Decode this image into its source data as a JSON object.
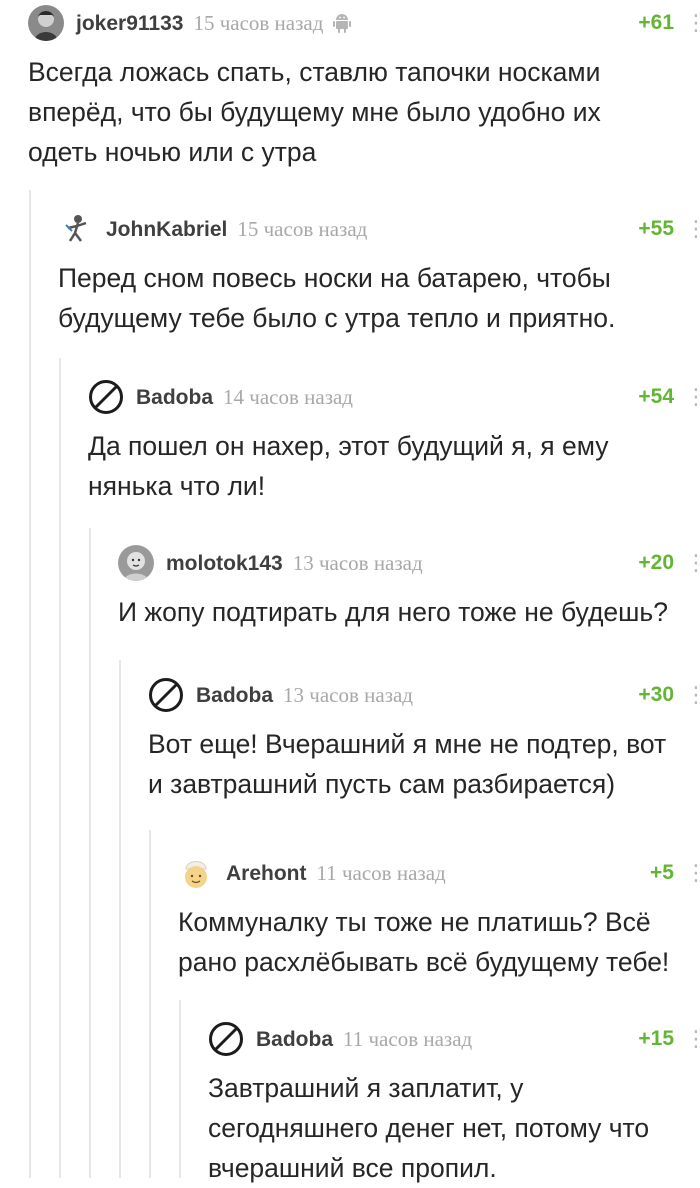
{
  "comments": [
    {
      "user": "joker91133",
      "time": "15 часов назад",
      "rating": "+61",
      "avatar": "portrait-avatar",
      "device": "android-icon",
      "text": "Всегда ложась спать, ставлю тапочки носками\nвперёд, что бы будущему мне было удобно их\nодеть ночью или с утра"
    },
    {
      "user": "JohnKabriel",
      "time": "15 часов назад",
      "rating": "+55",
      "avatar": "figure-avatar",
      "text": "Перед сном повесь носки на батарею, чтобы\nбудущему тебе было с утра тепло и приятно."
    },
    {
      "user": "Badoba",
      "time": "14 часов назад",
      "rating": "+54",
      "avatar": "no-avatar-icon",
      "text": "Да пошел он нахер, этот будущий я, я ему\nнянька что ли!"
    },
    {
      "user": "molotok143",
      "time": "13 часов назад",
      "rating": "+20",
      "avatar": "baby-avatar",
      "text": "И жопу подтирать для него тоже не будешь?"
    },
    {
      "user": "Badoba",
      "time": "13 часов назад",
      "rating": "+30",
      "avatar": "no-avatar-icon",
      "text": "Вот еще! Вчерашний я мне не подтер, вот\nи завтрашний пусть сам разбирается)"
    },
    {
      "user": "Arehont",
      "time": "11 часов назад",
      "rating": "+5",
      "avatar": "cartoon-avatar",
      "text": "Коммуналку ты тоже не платишь? Всё\nрано расхлёбывать всё будущему тебе!"
    },
    {
      "user": "Badoba",
      "time": "11 часов назад",
      "rating": "+15",
      "avatar": "no-avatar-icon",
      "text": "Завтрашний я заплатит, у\nсегодняшнего денег нет, потому что\nвчерашний все пропил."
    }
  ],
  "colors": {
    "rating": "#63b534",
    "time": "#a8a8a8",
    "username": "#3f3f3f",
    "thread_line": "#e6e6e6"
  }
}
